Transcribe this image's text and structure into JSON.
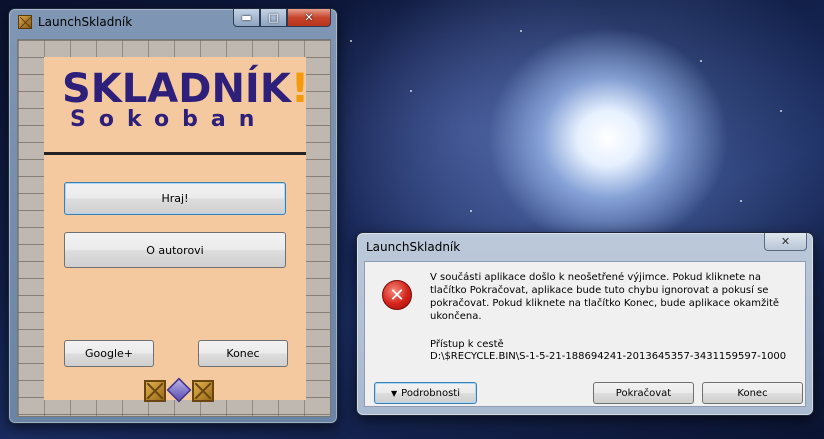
{
  "game_window": {
    "title": "LaunchSkladník",
    "controls": {
      "minimize": "▬",
      "maximize": "□",
      "close": "✕"
    },
    "logo": {
      "main": "SKLADNÍK",
      "exclamation": "!",
      "subtitle": "Sokoban"
    },
    "buttons": {
      "play": "Hraj!",
      "about": "O autorovi",
      "google_plus": "Google+",
      "quit": "Konec"
    },
    "colors": {
      "panel": "#f4c9a0",
      "logo": "#2d1f7a",
      "logo_accent": "#f39a0e"
    }
  },
  "error_dialog": {
    "title": "LaunchSkladník",
    "close_label": "✕",
    "icon": "error-icon",
    "message": "V součásti aplikace došlo k neošetřené výjimce. Pokud kliknete na tlačítko Pokračovat, aplikace bude tuto chybu ignorovat a pokusí se pokračovat. Pokud kliknete na tlačítko Konec, bude aplikace okamžitě ukončena.",
    "path_label": "Přístup k cestě",
    "path": "D:\\$RECYCLE.BIN\\S-1-5-21-188694241-2013645357-3431159597-1000",
    "buttons": {
      "details": "Podrobnosti",
      "continue": "Pokračovat",
      "end": "Konec"
    }
  }
}
